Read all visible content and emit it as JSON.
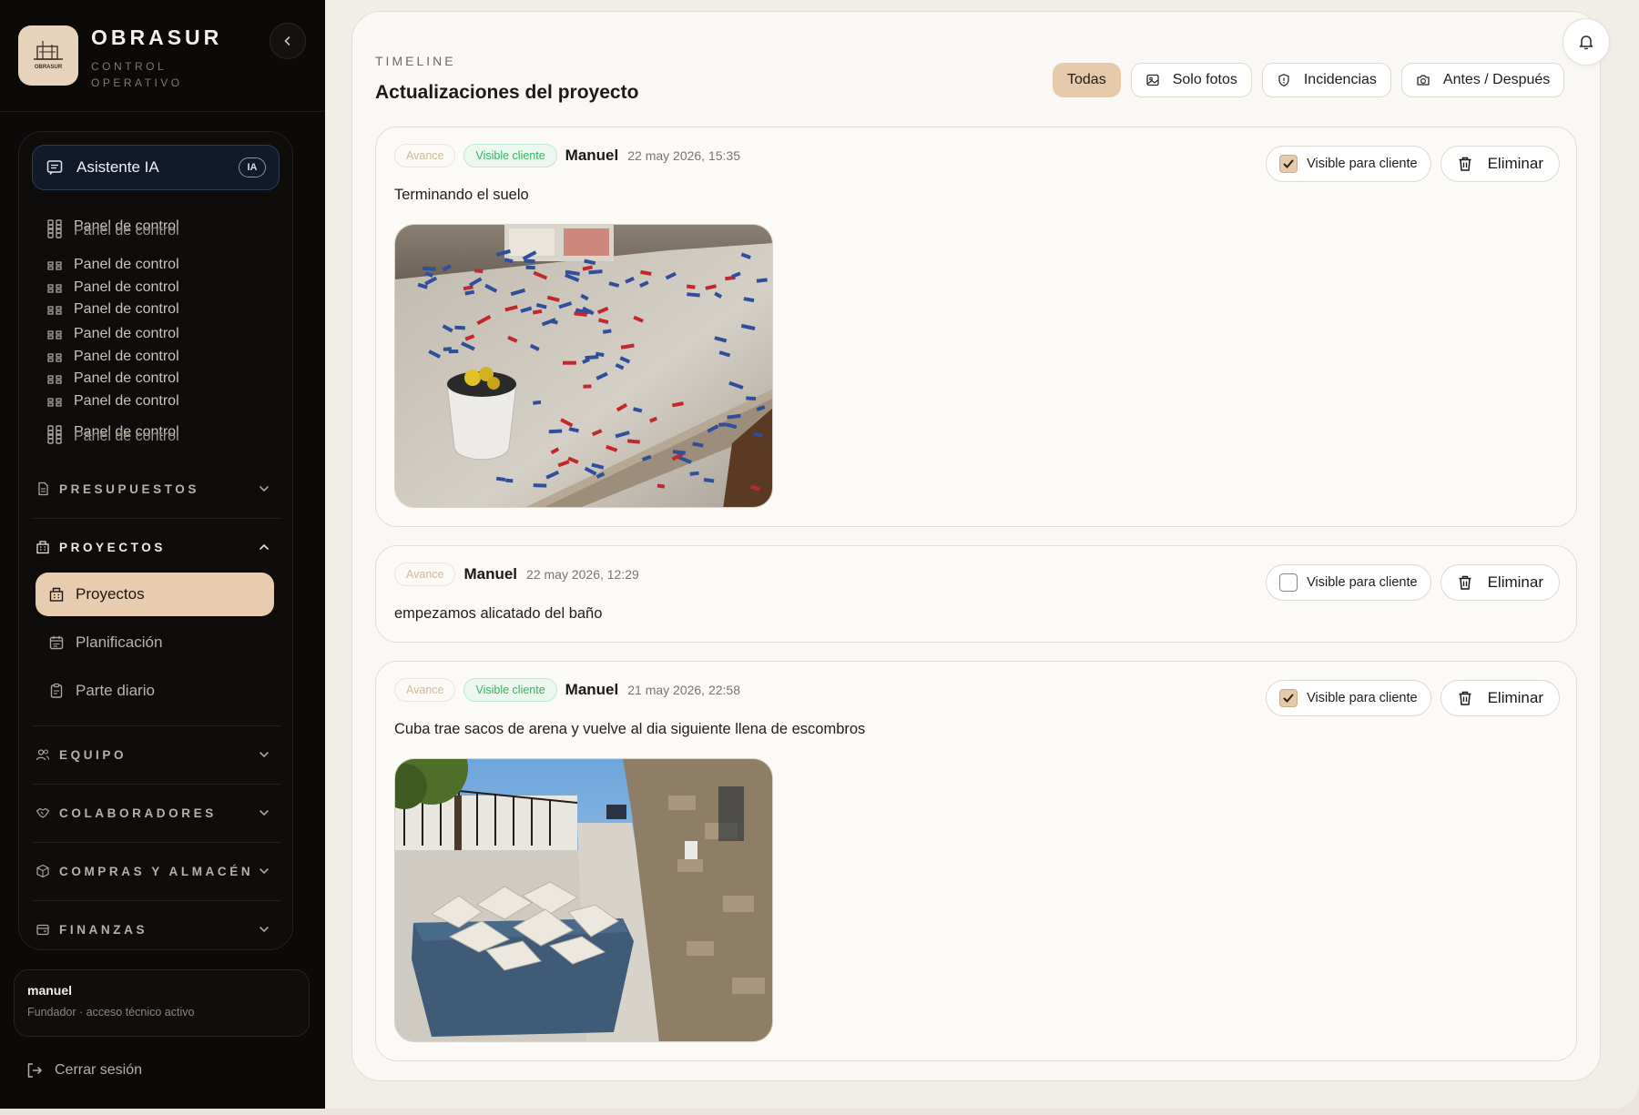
{
  "app": {
    "brand_name": "OBRASUR",
    "brand_sub": "CONTROL OPERATIVO",
    "logo_text": "OBRASUR"
  },
  "sidebar": {
    "assistant_label": "Asistente IA",
    "assistant_badge": "IA",
    "panel_items": [
      "Panel de control",
      "Panel de control",
      "Panel de control",
      "Panel de control",
      "Panel de control",
      "Panel de control",
      "Panel de control",
      "Panel de control",
      "Panel de control",
      "Panel de control",
      "Panel de control",
      "Panel de control"
    ],
    "groups": {
      "presupuestos": "PRESUPUESTOS",
      "proyectos": "PROYECTOS",
      "equipo": "EQUIPO",
      "colaboradores": "COLABORADORES",
      "compras": "COMPRAS Y ALMACÉN",
      "finanzas": "FINANZAS"
    },
    "proyectos_items": [
      "Proyectos",
      "Planificación",
      "Parte diario"
    ],
    "user": {
      "name": "manuel",
      "role": "Fundador · acceso técnico activo"
    },
    "logout_label": "Cerrar sesión"
  },
  "timeline": {
    "kicker": "TIMELINE",
    "title": "Actualizaciones del proyecto",
    "filters": [
      "Todas",
      "Solo fotos",
      "Incidencias",
      "Antes / Después"
    ],
    "active_filter": "Todas",
    "visible_label": "Visible para cliente",
    "delete_label": "Eliminar",
    "entries": [
      {
        "badge_type": "Avance",
        "badge_visible": "Visible cliente",
        "author": "Manuel",
        "timestamp": "22 may 2026, 15:35",
        "text": "Terminando el suelo",
        "client_visible": true,
        "has_photo": true
      },
      {
        "badge_type": "Avance",
        "author": "Manuel",
        "timestamp": "22 may 2026, 12:29",
        "text": "empezamos alicatado del baño",
        "client_visible": false,
        "has_photo": false
      },
      {
        "badge_type": "Avance",
        "badge_visible": "Visible cliente",
        "author": "Manuel",
        "timestamp": "21 may 2026, 22:58",
        "text": "Cuba trae sacos de arena y vuelve al dia siguiente llena de escombros",
        "client_visible": true,
        "has_photo": true
      }
    ]
  },
  "colors": {
    "accent": "#e5c9ab",
    "sidebar_bg": "#0b0a09",
    "visible_green": "#37b262",
    "avance_tan": "#d3b796"
  }
}
